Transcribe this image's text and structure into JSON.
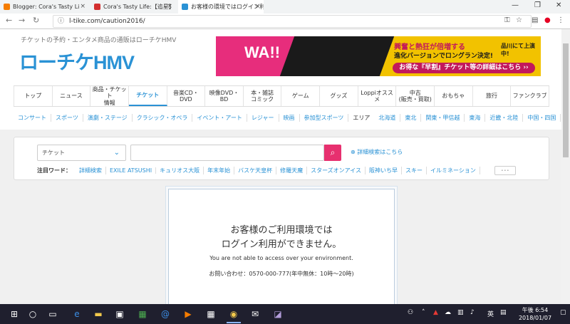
{
  "browser": {
    "tabs": [
      {
        "title": "Blogger: Cora's Tasty Li",
        "favicon_color": "#f57c00"
      },
      {
        "title": "Cora's Tasty Life:【追星】",
        "favicon_color": "#d32f2f"
      },
      {
        "title": "お客様の環境ではログイン利",
        "favicon_color": "#2a92d5"
      }
    ],
    "url": "l-tike.com/caution2016/"
  },
  "header": {
    "tagline": "チケットの予約・エンタメ商品の通販はローチケHMV",
    "logo_kana": "ローチケ",
    "logo_hmv": "HMV",
    "banner": {
      "brand": "WA!!",
      "line1": "興奮と熱狂が倍増する",
      "line2": "進化バージョンでロングラン決定!",
      "line3": "品川にて上演中!",
      "cta": "お得な『早割』チケット等の詳細はこちら ››"
    }
  },
  "mainnav": [
    "トップ",
    "ニュース",
    "商品・チケット\n情報",
    "チケット",
    "音楽CD・DVD",
    "映像DVD・BD",
    "本・雑誌\nコミック",
    "ゲーム",
    "グッズ",
    "Loppiオススメ",
    "中古\n(販売・買取)",
    "おもちゃ",
    "旅行",
    "ファンクラブ"
  ],
  "subnav": [
    "コンサート",
    "スポーツ",
    "演劇・ステージ",
    "クラシック・オペラ",
    "イベント・アート",
    "レジャー",
    "映画",
    "参加型スポーツ"
  ],
  "subnav_area_label": "エリア",
  "subnav_areas": [
    "北海道",
    "東北",
    "関東・甲信越",
    "東海",
    "近畿・北陸",
    "中国・四国"
  ],
  "subnav_more": "･･･",
  "search": {
    "category": "チケット",
    "advanced": "詳細検索はこちら",
    "hot_label": "注目ワード：",
    "hot_words": [
      "詳細検索",
      "EXILE ATSUSHI",
      "キュリオス大阪",
      "年末年始",
      "バスケ天皇杯",
      "修羅天魔",
      "スターズオンアイス",
      "阪神いち早",
      "スキー",
      "イルミネーション"
    ],
    "more": "･･･"
  },
  "notice": {
    "line1": "お客様のご利用環境では",
    "line2": "ログイン利用ができません。",
    "english": "You are not able to access over your environment.",
    "contact": "お問い合わせ：0570-000-777(年中無休：10時～20時)"
  },
  "taskbar": {
    "time": "午後 6:54",
    "date": "2018/01/07",
    "ime": "英"
  }
}
